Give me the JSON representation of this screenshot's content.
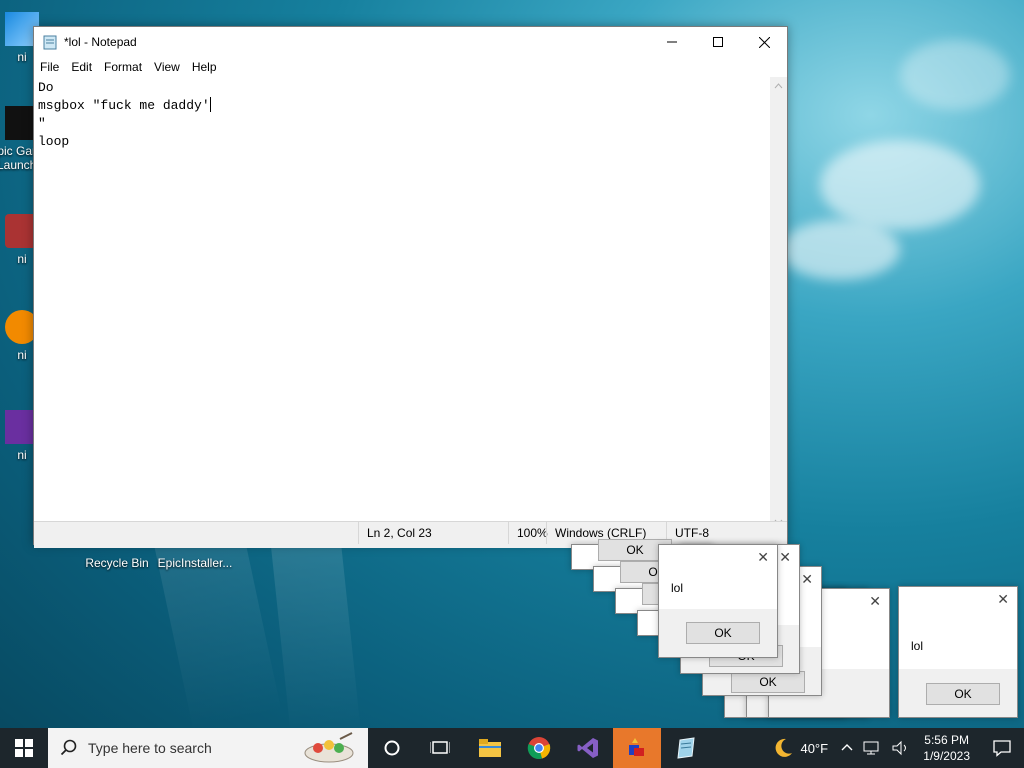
{
  "desktop": {
    "icons": [
      {
        "label": "ni"
      },
      {
        "label": "Epic Games Launcher"
      },
      {
        "label": "ni"
      },
      {
        "label": "ni"
      },
      {
        "label": "ni"
      },
      {
        "label": "Recycle Bin"
      },
      {
        "label": "EpicInstaller..."
      }
    ]
  },
  "notepad": {
    "title": "*lol - Notepad",
    "menu": [
      "File",
      "Edit",
      "Format",
      "View",
      "Help"
    ],
    "lines": [
      "Do",
      "msgbox \"fuck me daddy'",
      "\"",
      "loop"
    ],
    "status": {
      "position": "Ln 2, Col 23",
      "zoom": "100%",
      "line_ending": "Windows (CRLF)",
      "encoding": "UTF-8"
    }
  },
  "msgbox": {
    "message": "lol",
    "ok_label": "OK",
    "close_glyph": "✕"
  },
  "taskbar": {
    "search_placeholder": "Type here to search",
    "weather_temp": "40°F",
    "time": "5:56 PM",
    "date": "1/9/2023"
  },
  "colors": {
    "taskbar": "#1d262c",
    "accent": "#0078d7"
  }
}
